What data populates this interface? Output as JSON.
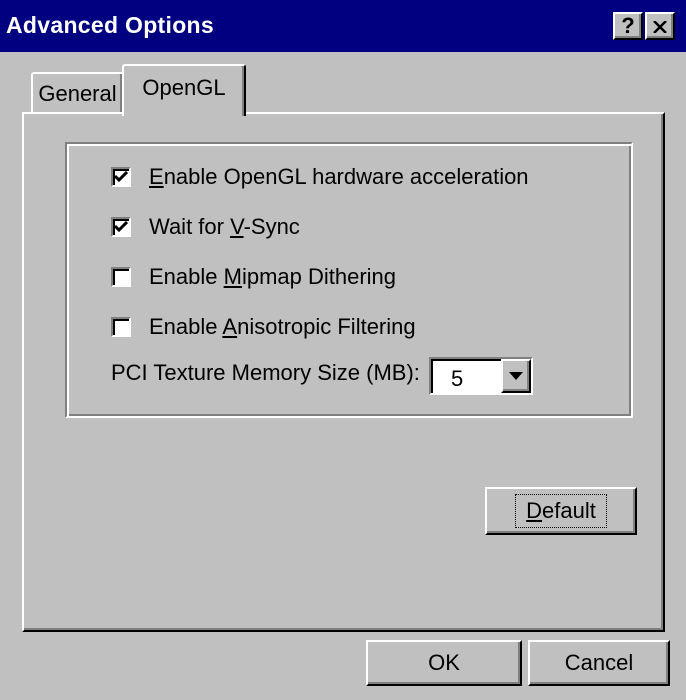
{
  "window": {
    "title": "Advanced Options",
    "help_label": "?",
    "close_label": "×"
  },
  "tabs": [
    {
      "label": "General",
      "selected": false
    },
    {
      "label": "OpenGL",
      "selected": true
    }
  ],
  "options": [
    {
      "prefix": "",
      "mnemonic": "E",
      "suffix": "nable OpenGL hardware acceleration",
      "checked": true
    },
    {
      "prefix": "Wait for ",
      "mnemonic": "V",
      "suffix": "-Sync",
      "checked": true
    },
    {
      "prefix": "Enable ",
      "mnemonic": "M",
      "suffix": "ipmap Dithering",
      "checked": false
    },
    {
      "prefix": "Enable ",
      "mnemonic": "A",
      "suffix": "nisotropic Filtering",
      "checked": false
    }
  ],
  "texture_memory": {
    "label": "PCI Texture Memory Size (MB):",
    "value": "5"
  },
  "buttons": {
    "default_mnemonic": "D",
    "default_rest": "efault",
    "ok": "OK",
    "cancel": "Cancel"
  },
  "colors": {
    "titlebar": "#000080",
    "face": "#c0c0c0"
  }
}
